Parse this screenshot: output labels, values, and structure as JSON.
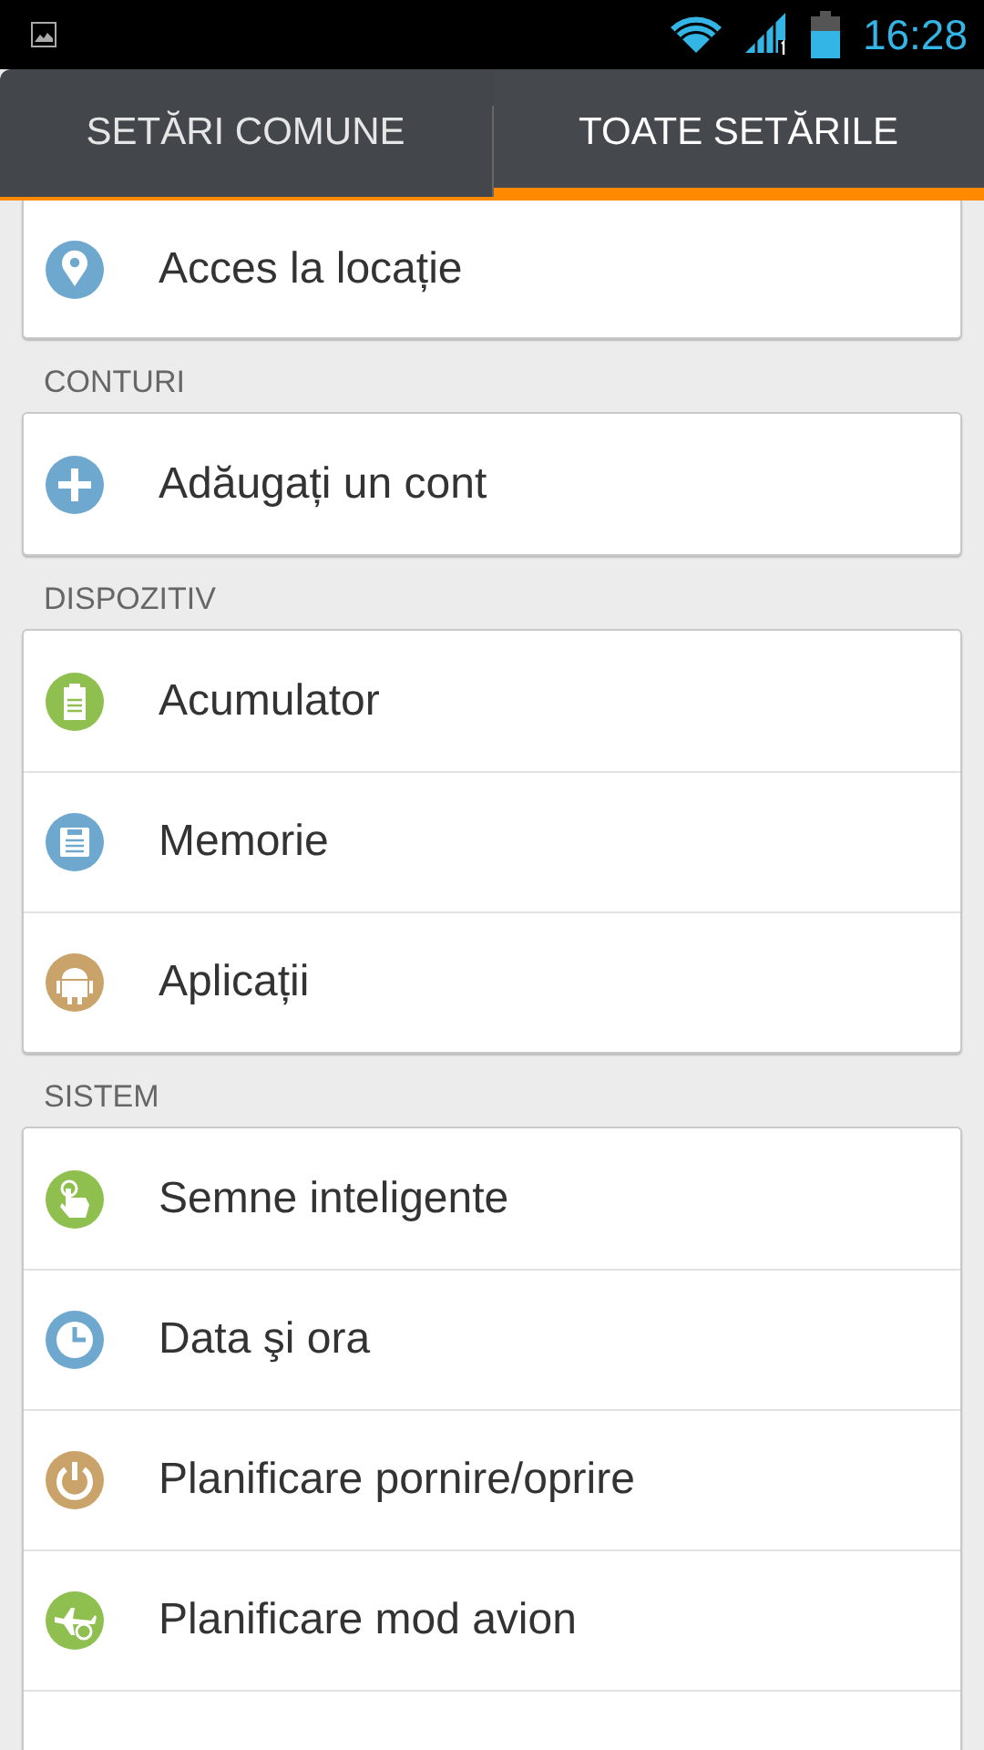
{
  "status_bar": {
    "time": "16:28"
  },
  "tabs": [
    {
      "label": "SETĂRI COMUNE",
      "selected": false
    },
    {
      "label": "TOATE SETĂRILE",
      "selected": true
    }
  ],
  "sections": [
    {
      "items": [
        {
          "kind": "location",
          "label": "Acces la locație"
        }
      ]
    },
    {
      "header": "CONTURI",
      "items": [
        {
          "kind": "add",
          "label": "Adăugați un cont"
        }
      ]
    },
    {
      "header": "DISPOZITIV",
      "items": [
        {
          "kind": "battery",
          "label": "Acumulator"
        },
        {
          "kind": "storage",
          "label": "Memorie"
        },
        {
          "kind": "android",
          "label": "Aplicații"
        }
      ]
    },
    {
      "header": "SISTEM",
      "items": [
        {
          "kind": "gesture",
          "label": "Semne inteligente"
        },
        {
          "kind": "clock",
          "label": "Data şi ora"
        },
        {
          "kind": "power",
          "label": "Planificare pornire/oprire"
        },
        {
          "kind": "airplane",
          "label": "Planificare mod avion"
        }
      ]
    }
  ]
}
